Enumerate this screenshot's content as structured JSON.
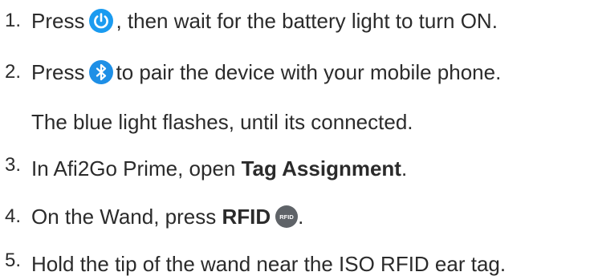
{
  "steps": [
    {
      "number": "1.",
      "before": "Press",
      "icon": "power-icon",
      "after": ", then wait for the battery light to turn ON."
    },
    {
      "number": "2.",
      "before": "Press",
      "icon": "bluetooth-icon",
      "after": " to pair the device with your mobile phone.",
      "continuation": "The blue light flashes, until its connected."
    },
    {
      "number": "3.",
      "before": "In Afi2Go Prime, open ",
      "bold": "Tag Assignment",
      "after": "."
    },
    {
      "number": "4.",
      "before": "On the Wand, press ",
      "bold": "RFID",
      "icon": "rfid-button-icon",
      "icon_label": "RFID",
      "after": "."
    },
    {
      "number": "5.",
      "before": "Hold the tip of the wand near the ISO RFID ear tag."
    }
  ],
  "colors": {
    "text": "#2b2b2b",
    "power_icon": "#1a9bf0",
    "bluetooth_icon": "#1e8fe6",
    "rfid_button": "#5f6368"
  }
}
